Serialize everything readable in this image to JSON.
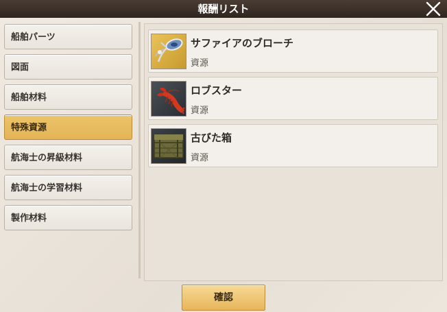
{
  "window": {
    "title": "報酬リスト",
    "close_icon": "close-x-icon"
  },
  "categories": [
    {
      "label": "船舶パーツ",
      "selected": false
    },
    {
      "label": "図面",
      "selected": false
    },
    {
      "label": "船舶材料",
      "selected": false
    },
    {
      "label": "特殊資源",
      "selected": true
    },
    {
      "label": "航海士の昇級材料",
      "selected": false
    },
    {
      "label": "航海士の学習材料",
      "selected": false
    },
    {
      "label": "製作材料",
      "selected": false
    }
  ],
  "rewards": [
    {
      "name": "サファイアのブローチ",
      "type": "資源",
      "icon": "brooch-icon"
    },
    {
      "name": "ロブスター",
      "type": "資源",
      "icon": "lobster-icon"
    },
    {
      "name": "古びた箱",
      "type": "資源",
      "icon": "old-crate-icon"
    }
  ],
  "confirm_label": "確認",
  "colors": {
    "selected_tab": "#e3b457",
    "title_bar": "#3a2e28",
    "confirm_button": "#ecc572"
  }
}
